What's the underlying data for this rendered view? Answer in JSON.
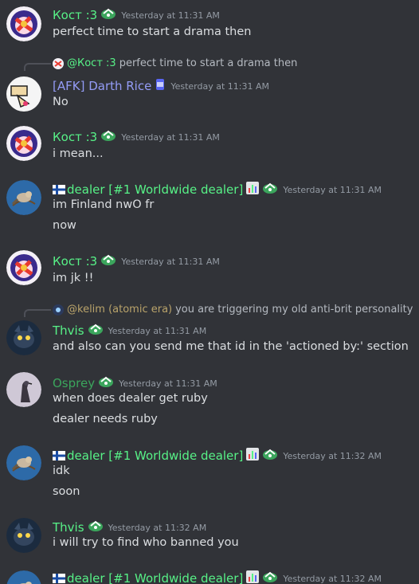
{
  "colors": {
    "background": "#313338",
    "text": "#dbdee1",
    "timestamp": "#949ba4",
    "green_name": "#57f287",
    "darth_name": "#949cf7",
    "osprey_name": "#3ba55c",
    "kelim_name": "#b9a36a"
  },
  "messages": [
    {
      "author": "Кост :3",
      "timestamp": "Yesterday at 11:31 AM",
      "lines": [
        "perfect time to start a drama then"
      ]
    },
    {
      "reply_to_author": "@Кост :3",
      "reply_text": "perfect time to start a drama then",
      "author": "[AFK] Darth Rice",
      "timestamp": "Yesterday at 11:31 AM",
      "lines": [
        "No"
      ]
    },
    {
      "author": "Кост :3",
      "timestamp": "Yesterday at 11:31 AM",
      "lines": [
        "i mean..."
      ]
    },
    {
      "author": "dealer [#1 Worldwide dealer]",
      "timestamp": "Yesterday at 11:31 AM",
      "lines": [
        "im Finland nwO fr",
        "now"
      ]
    },
    {
      "author": "Кост :3",
      "timestamp": "Yesterday at 11:31 AM",
      "lines": [
        "im jk !!"
      ]
    },
    {
      "reply_to_author": "@kelim (atomic era)",
      "reply_text": "you are triggering my old anti-brit personality",
      "author": "Thvis",
      "timestamp": "Yesterday at 11:31 AM",
      "lines": [
        "and also can you send me that id in the 'actioned by:' section"
      ]
    },
    {
      "author": "Osprey",
      "timestamp": "Yesterday at 11:31 AM",
      "lines": [
        "when does dealer get ruby",
        "dealer needs ruby"
      ]
    },
    {
      "author": "dealer [#1 Worldwide dealer]",
      "timestamp": "Yesterday at 11:32 AM",
      "lines": [
        "idk",
        "soon"
      ]
    },
    {
      "author": "Thvis",
      "timestamp": "Yesterday at 11:32 AM",
      "lines": [
        "i will try to find who banned you"
      ]
    },
    {
      "author": "dealer [#1 Worldwide dealer]",
      "timestamp": "Yesterday at 11:32 AM",
      "lines": []
    }
  ]
}
